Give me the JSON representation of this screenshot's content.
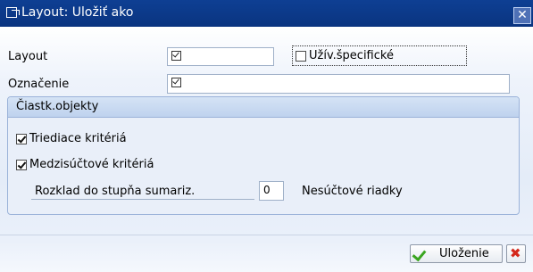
{
  "window": {
    "title": "Layout: Uložiť ako",
    "close_symbol": "✕"
  },
  "form": {
    "layout_label": "Layout",
    "layout_value": "",
    "user_specific_label": "Užív.špecifické",
    "user_specific_checked": false,
    "designation_label": "Označenie",
    "designation_value": ""
  },
  "subobjects": {
    "header": "Čiastk.objekty",
    "sort_criteria_label": "Triediace kritériá",
    "sort_criteria_checked": true,
    "subtotal_criteria_label": "Medzisúčtové kritériá",
    "subtotal_criteria_checked": true,
    "breakdown_label": "Rozklad do stupňa sumariz.",
    "breakdown_value": "0",
    "non_total_rows_label": "Nesúčtové riadky"
  },
  "footer": {
    "save_label": "Uloženie"
  },
  "icons": {
    "title": "save-as-icon",
    "field_marker": "checkbox-required-icon",
    "save": "green-check-icon",
    "cancel": "red-x-icon"
  },
  "colors": {
    "titlebar": "#0e3f93",
    "group_background": "#e9eff9",
    "group_header": "#c7d8f0",
    "save_check": "#3aa51f",
    "cancel_x": "#d4271b"
  }
}
